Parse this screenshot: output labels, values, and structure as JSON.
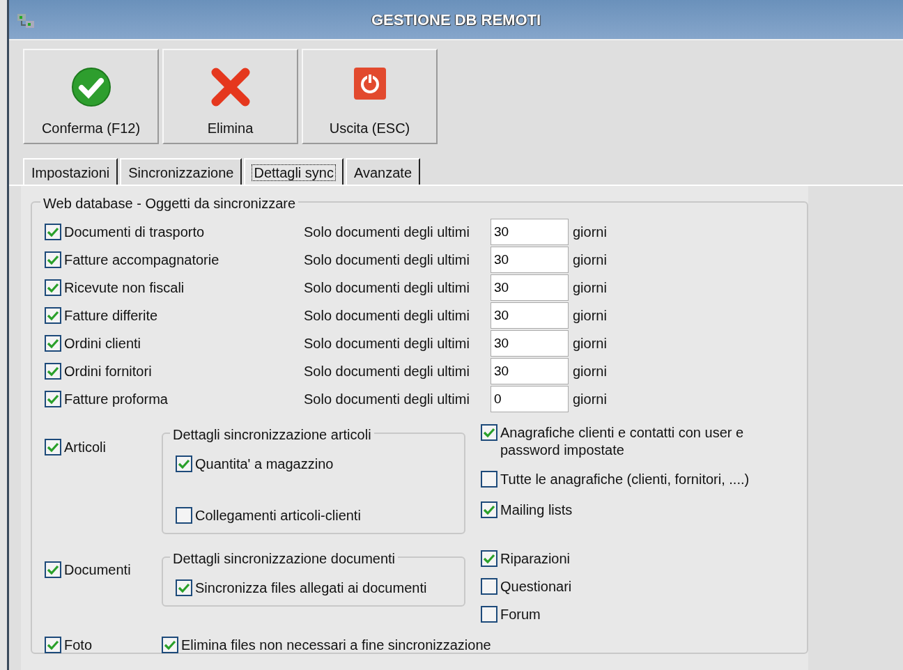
{
  "window": {
    "title": "GESTIONE DB REMOTI"
  },
  "toolbar": [
    {
      "label": "Conferma (F12)",
      "kind": "confirm"
    },
    {
      "label": "Elimina",
      "kind": "delete"
    },
    {
      "label": "Uscita (ESC)",
      "kind": "exit"
    }
  ],
  "tabs": [
    {
      "label": "Impostazioni",
      "selected": false
    },
    {
      "label": "Sincronizzazione",
      "selected": false
    },
    {
      "label": "Dettagli sync",
      "selected": true
    },
    {
      "label": "Avanzate",
      "selected": false
    }
  ],
  "group": {
    "title": "Web database - Oggetti da sincronizzare"
  },
  "document_rows": [
    {
      "label": "Documenti di trasporto",
      "checked": true,
      "prefix": "Solo documenti degli ultimi",
      "value": "30",
      "suffix": "giorni"
    },
    {
      "label": "Fatture accompagnatorie",
      "checked": true,
      "prefix": "Solo documenti degli ultimi",
      "value": "30",
      "suffix": "giorni"
    },
    {
      "label": "Ricevute non fiscali",
      "checked": true,
      "prefix": "Solo documenti degli ultimi",
      "value": "30",
      "suffix": "giorni"
    },
    {
      "label": "Fatture differite",
      "checked": true,
      "prefix": "Solo documenti degli ultimi",
      "value": "30",
      "suffix": "giorni"
    },
    {
      "label": "Ordini clienti",
      "checked": true,
      "prefix": "Solo documenti degli ultimi",
      "value": "30",
      "suffix": "giorni"
    },
    {
      "label": "Ordini fornitori",
      "checked": true,
      "prefix": "Solo documenti degli ultimi",
      "value": "30",
      "suffix": "giorni"
    },
    {
      "label": "Fatture proforma",
      "checked": true,
      "prefix": "Solo documenti degli ultimi",
      "value": "0",
      "suffix": "giorni"
    }
  ],
  "articoli": {
    "label": "Articoli",
    "checked": true,
    "group_title": "Dettagli sincronizzazione articoli",
    "options": [
      {
        "label": "Quantita' a magazzino",
        "checked": true
      },
      {
        "label": "Collegamenti articoli-clienti",
        "checked": false
      }
    ]
  },
  "anagrafiche_options": [
    {
      "label": "Anagrafiche clienti e contatti con user e password impostate",
      "checked": true
    },
    {
      "label": "Tutte le anagrafiche (clienti, fornitori, ....)",
      "checked": false
    },
    {
      "label": "Mailing lists",
      "checked": true
    }
  ],
  "documenti": {
    "label": "Documenti",
    "checked": true,
    "group_title": "Dettagli sincronizzazione documenti",
    "options": [
      {
        "label": "Sincronizza files allegati ai documenti",
        "checked": true
      }
    ]
  },
  "extra_options": [
    {
      "label": "Riparazioni",
      "checked": true
    },
    {
      "label": "Questionari",
      "checked": false
    },
    {
      "label": "Forum",
      "checked": false
    }
  ],
  "foto": {
    "label": "Foto",
    "checked": true
  },
  "cleanup": {
    "label": "Elimina files non necessari a fine sincronizzazione",
    "checked": true
  }
}
